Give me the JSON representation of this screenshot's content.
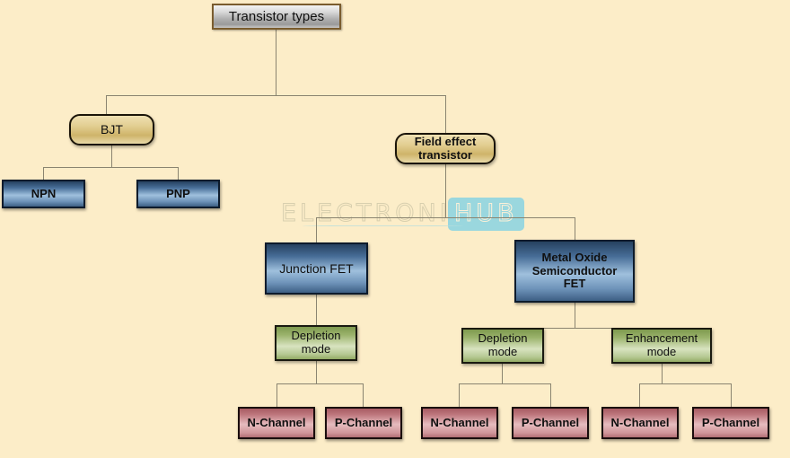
{
  "diagram": {
    "title": "Transistor types",
    "background_color": "#fcedc8",
    "connector_color": "#8a8470"
  },
  "watermark": {
    "word1": "ELECTRONICS",
    "word2": "HUB",
    "badge_color": "#9ad7de",
    "text_color": "#d8cfae"
  },
  "nodes": {
    "root": {
      "label": "Transistor types",
      "fill": "#c9c9c9",
      "border": "#7a5c2e"
    },
    "bjt": {
      "label": "BJT",
      "fill": "#e3cf93",
      "border": "#1a1408"
    },
    "fet": {
      "label": "Field effect\ntransistor",
      "fill": "#e3cf93",
      "border": "#1a1408"
    },
    "npn": {
      "label": "NPN",
      "fill": "#6d92b8",
      "border": "#0d1b2c"
    },
    "pnp": {
      "label": "PNP",
      "fill": "#6d92b8",
      "border": "#0d1b2c"
    },
    "jfet": {
      "label": "Junction FET",
      "fill": "#6d92b8",
      "border": "#0d1b2c"
    },
    "mosfet": {
      "label": "Metal Oxide\nSemiconductor\nFET",
      "fill": "#6d92b8",
      "border": "#0d1b2c"
    },
    "jfet_depletion": {
      "label": "Depletion\nmode",
      "fill": "#b5c892",
      "border": "#1a1a10"
    },
    "mos_depletion": {
      "label": "Depletion\nmode",
      "fill": "#b5c892",
      "border": "#1a1a10"
    },
    "mos_enhancement": {
      "label": "Enhancement\nmode",
      "fill": "#b5c892",
      "border": "#1a1a10"
    },
    "jfet_dep_n": {
      "label": "N-Channel",
      "fill": "#cf9499",
      "border": "#1a0d0d"
    },
    "jfet_dep_p": {
      "label": "P-Channel",
      "fill": "#cf9499",
      "border": "#1a0d0d"
    },
    "mos_dep_n": {
      "label": "N-Channel",
      "fill": "#cf9499",
      "border": "#1a0d0d"
    },
    "mos_dep_p": {
      "label": "P-Channel",
      "fill": "#cf9499",
      "border": "#1a0d0d"
    },
    "mos_enh_n": {
      "label": "N-Channel",
      "fill": "#cf9499",
      "border": "#1a0d0d"
    },
    "mos_enh_p": {
      "label": "P-Channel",
      "fill": "#cf9499",
      "border": "#1a0d0d"
    }
  }
}
